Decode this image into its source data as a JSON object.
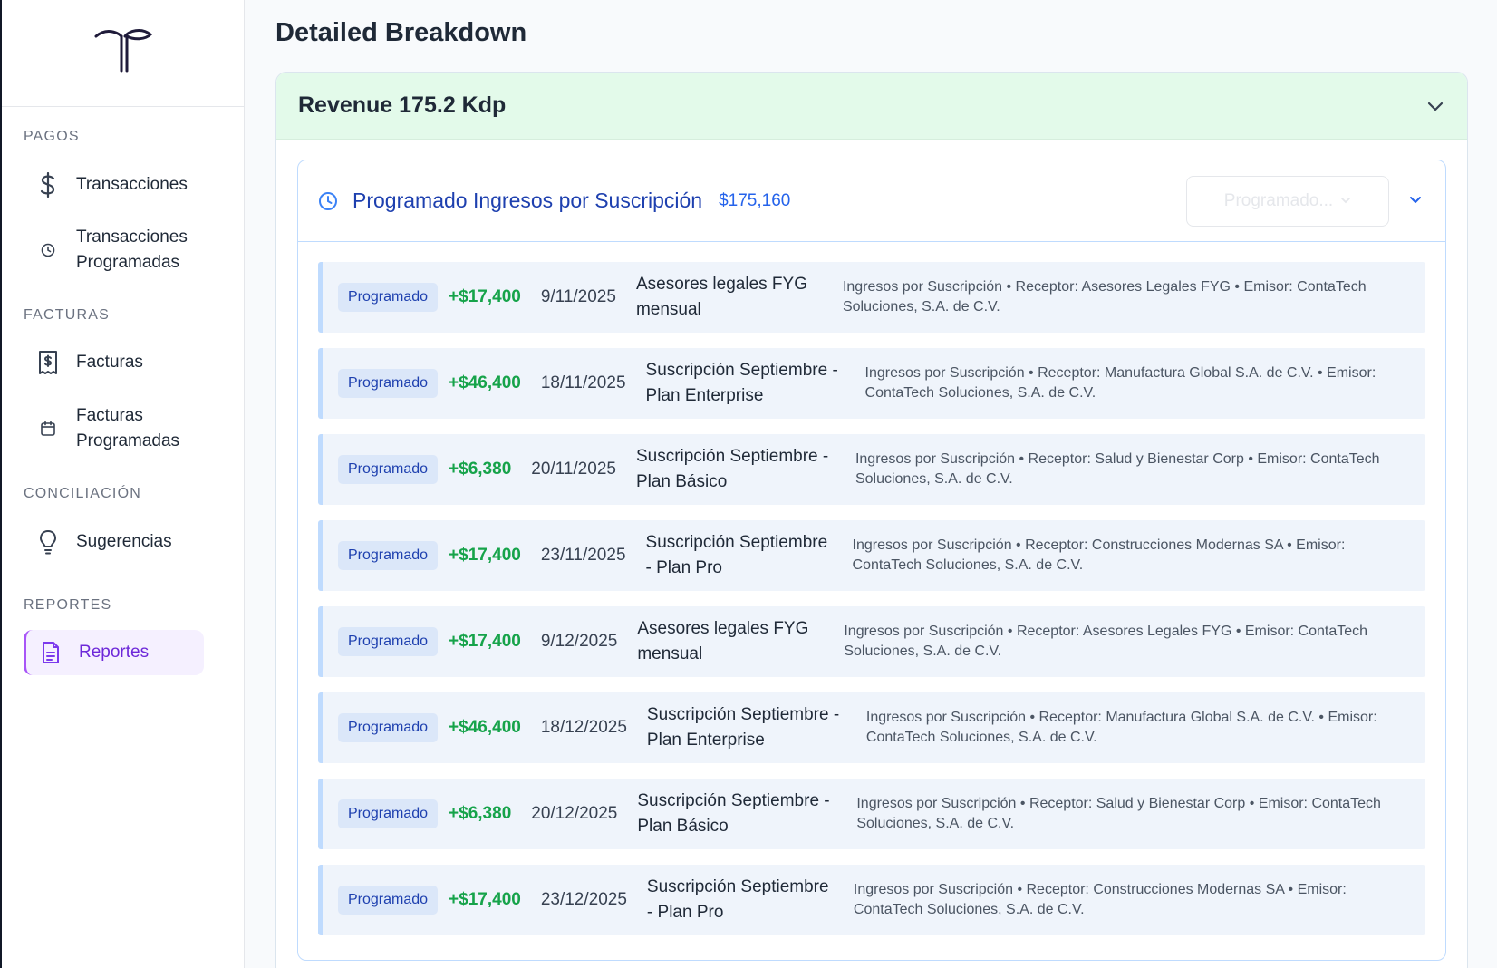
{
  "sidebar": {
    "sections": [
      {
        "label": "PAGOS",
        "items": [
          {
            "label": "Transacciones",
            "icon": "dollar-icon"
          },
          {
            "label": "Transacciones Programadas",
            "icon": "clock-icon"
          }
        ]
      },
      {
        "label": "FACTURAS",
        "items": [
          {
            "label": "Facturas",
            "icon": "receipt-icon"
          },
          {
            "label": "Facturas Programadas",
            "icon": "calendar-icon"
          }
        ]
      },
      {
        "label": "CONCILIACIÓN",
        "items": [
          {
            "label": "Sugerencias",
            "icon": "lightbulb-icon"
          }
        ]
      },
      {
        "label": "REPORTES",
        "items": [
          {
            "label": "Reportes",
            "icon": "document-icon",
            "active": true
          }
        ]
      }
    ]
  },
  "main": {
    "title": "Detailed Breakdown",
    "revenue": {
      "title": "Revenue 175.2 Kdp",
      "group": {
        "title": "Programado Ingresos por Suscripción",
        "total": "$175,160",
        "filter_value": "Programado...",
        "rows": [
          {
            "status": "Programado",
            "amount": "+$17,400",
            "date": "9/11/2025",
            "concept": "Asesores legales FYG mensual",
            "description": "Ingresos por Suscripción • Receptor: Asesores Legales FYG • Emisor: ContaTech Soluciones, S.A. de C.V."
          },
          {
            "status": "Programado",
            "amount": "+$46,400",
            "date": "18/11/2025",
            "concept": "Suscripción Septiembre - Plan Enterprise",
            "description": "Ingresos por Suscripción • Receptor: Manufactura Global S.A. de C.V. • Emisor: ContaTech Soluciones, S.A. de C.V."
          },
          {
            "status": "Programado",
            "amount": "+$6,380",
            "date": "20/11/2025",
            "concept": "Suscripción Septiembre - Plan Básico",
            "description": "Ingresos por Suscripción • Receptor: Salud y Bienestar Corp • Emisor: ContaTech Soluciones, S.A. de C.V."
          },
          {
            "status": "Programado",
            "amount": "+$17,400",
            "date": "23/11/2025",
            "concept": "Suscripción Septiembre - Plan Pro",
            "description": "Ingresos por Suscripción • Receptor: Construcciones Modernas SA • Emisor: ContaTech Soluciones, S.A. de C.V."
          },
          {
            "status": "Programado",
            "amount": "+$17,400",
            "date": "9/12/2025",
            "concept": "Asesores legales FYG mensual",
            "description": "Ingresos por Suscripción • Receptor: Asesores Legales FYG • Emisor: ContaTech Soluciones, S.A. de C.V."
          },
          {
            "status": "Programado",
            "amount": "+$46,400",
            "date": "18/12/2025",
            "concept": "Suscripción Septiembre - Plan Enterprise",
            "description": "Ingresos por Suscripción • Receptor: Manufactura Global S.A. de C.V. • Emisor: ContaTech Soluciones, S.A. de C.V."
          },
          {
            "status": "Programado",
            "amount": "+$6,380",
            "date": "20/12/2025",
            "concept": "Suscripción Septiembre - Plan Básico",
            "description": "Ingresos por Suscripción • Receptor: Salud y Bienestar Corp • Emisor: ContaTech Soluciones, S.A. de C.V."
          },
          {
            "status": "Programado",
            "amount": "+$17,400",
            "date": "23/12/2025",
            "concept": "Suscripción Septiembre - Plan Pro",
            "description": "Ingresos por Suscripción • Receptor: Construcciones Modernas SA • Emisor: ContaTech Soluciones, S.A. de C.V."
          }
        ]
      }
    }
  },
  "colors": {
    "accent_purple": "#7c3aed",
    "revenue_header_bg": "#e3faea",
    "group_blue": "#1e40af",
    "amount_green": "#16a34a"
  }
}
